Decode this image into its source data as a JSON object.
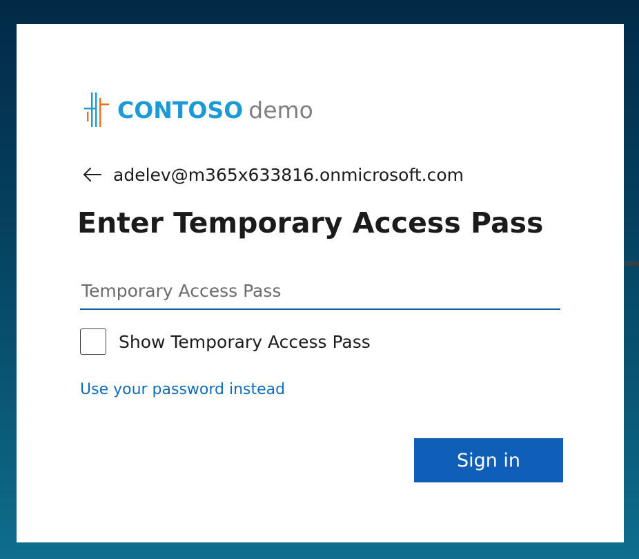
{
  "logo": {
    "brand": "CONTOSO",
    "suffix": "demo",
    "icon": "contoso-logo-icon",
    "brand_color": "#1b9ad6",
    "suffix_color": "#7f7f7f",
    "mark_colors": [
      "#1b9ad6",
      "#f26a21"
    ]
  },
  "identity": {
    "back_icon": "back-arrow-icon",
    "email": "adelev@m365x633816.onmicrosoft.com"
  },
  "page_title": "Enter Temporary Access Pass",
  "tap_input": {
    "placeholder": "Temporary Access Pass",
    "value": ""
  },
  "show_checkbox": {
    "label": "Show Temporary Access Pass",
    "checked": false
  },
  "alt_link": "Use your password instead",
  "signin_button": {
    "label": "Sign in",
    "color": "#0f5eb8"
  },
  "accent_color": "#0f6cbd"
}
